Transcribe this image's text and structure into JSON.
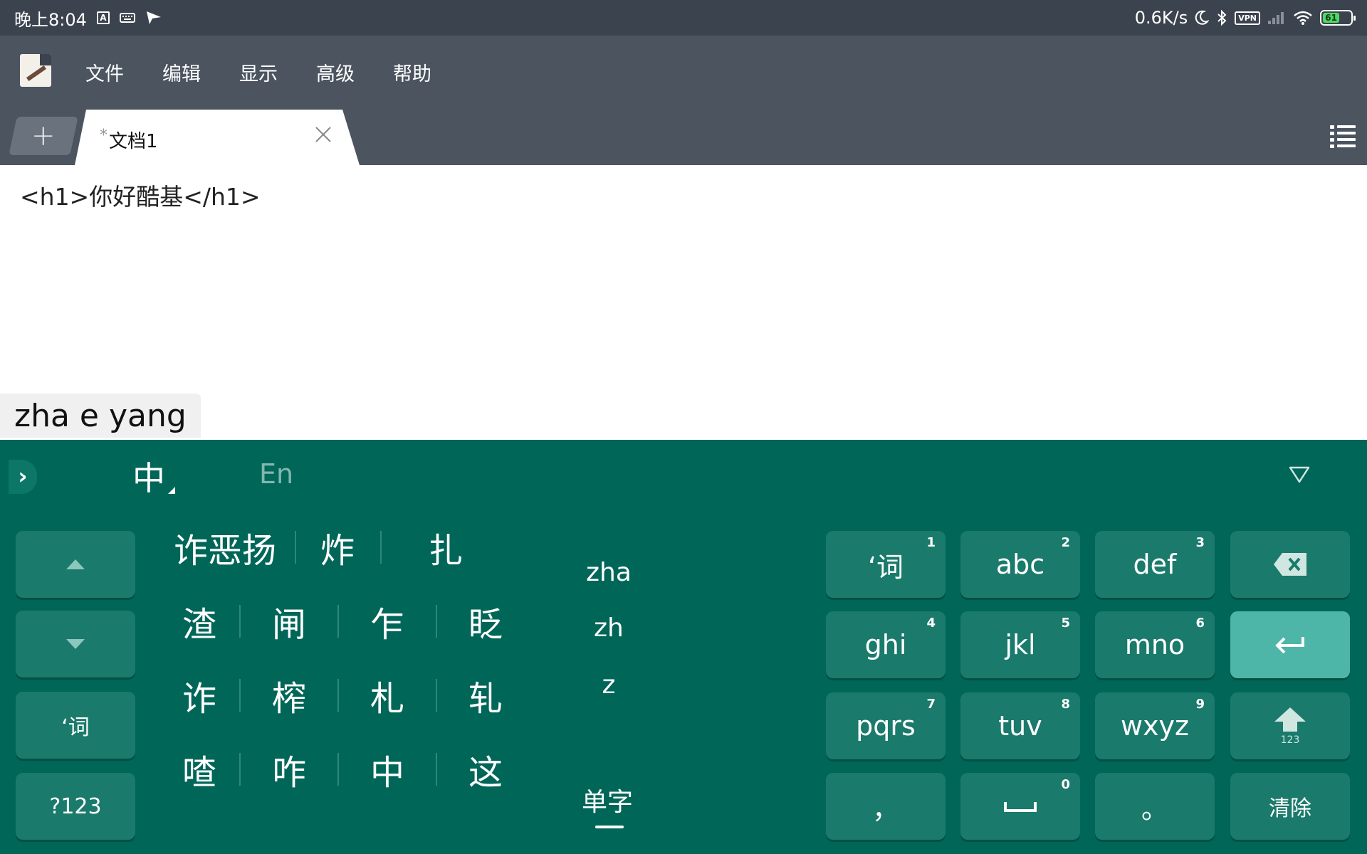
{
  "status_bar": {
    "time": "晚上8:04",
    "network_speed": "0.6K/s",
    "vpn": "VPN",
    "battery": "61",
    "icons": [
      "text-a-icon",
      "keyboard-icon",
      "send-icon",
      "moon-icon",
      "bluetooth-icon",
      "vpn-icon",
      "signal-icon",
      "wifi-icon",
      "battery-icon"
    ]
  },
  "app": {
    "menu": [
      "文件",
      "编辑",
      "显示",
      "高级",
      "帮助"
    ],
    "new_tab_label": "+",
    "tab": {
      "modified_marker": "*",
      "title": "文档1",
      "close_label": "×"
    }
  },
  "editor": {
    "line_1": "<h1>你好酷基</h1>"
  },
  "ime": {
    "composition": "zha e yang",
    "lang_zh": "中",
    "lang_en": "En",
    "candidates": [
      [
        "诈恶扬",
        "炸",
        "扎"
      ],
      [
        "渣",
        "闸",
        "乍",
        "眨"
      ],
      [
        "诈",
        "榨",
        "札",
        "轧"
      ],
      [
        "喳",
        "咋",
        "中",
        "这"
      ]
    ],
    "pinyin_options": [
      "zha",
      "zh",
      "z"
    ],
    "single_char_mode": "单字",
    "left_keys": {
      "up": "▲",
      "down": "▼",
      "word": "‘词",
      "symbols": "?123"
    },
    "keys": [
      {
        "label": "‘词",
        "num": "1"
      },
      {
        "label": "abc",
        "num": "2"
      },
      {
        "label": "def",
        "num": "3"
      },
      {
        "label": "ghi",
        "num": "4"
      },
      {
        "label": "jkl",
        "num": "5"
      },
      {
        "label": "mno",
        "num": "6"
      },
      {
        "label": "pqrs",
        "num": "7"
      },
      {
        "label": "tuv",
        "num": "8"
      },
      {
        "label": "wxyz",
        "num": "9"
      },
      {
        "label": "，",
        "num": ""
      },
      {
        "label": "⎵",
        "num": "0"
      },
      {
        "label": "。",
        "num": ""
      }
    ],
    "right_keys": {
      "backspace": "⌫",
      "enter": "↵",
      "shift_sub": "123",
      "clear": "清除"
    }
  }
}
